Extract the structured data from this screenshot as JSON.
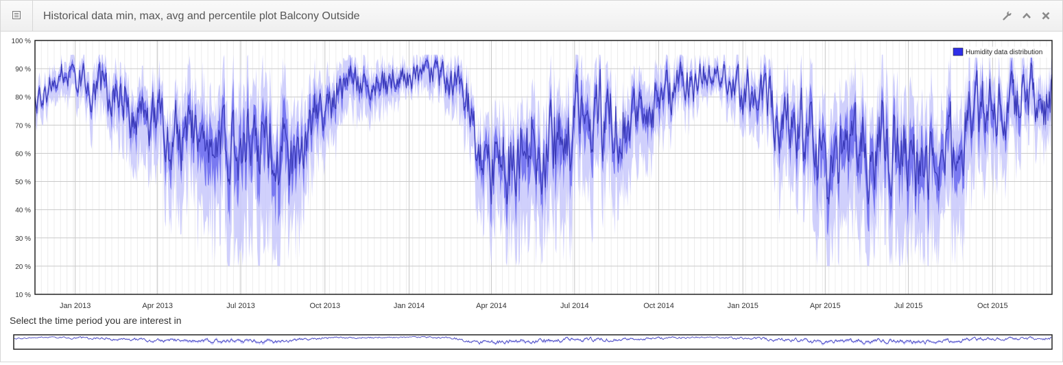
{
  "header": {
    "title": "Historical data min, max, avg and percentile plot Balcony Outside",
    "icons": [
      "list-icon",
      "wrench-icon",
      "chevron-up-icon",
      "close-icon"
    ]
  },
  "colors": {
    "avg_line": "#3a3ab8",
    "percentile_band": "#6a6aee",
    "minmax_band": "#c8c8fb",
    "legend_swatch": "#2f2fe8"
  },
  "legend": {
    "label": "Humidity data distribution",
    "position": "top-right"
  },
  "selector": {
    "label": "Select the time period you are interest in"
  },
  "chart_data": {
    "type": "area",
    "title": "Historical data min, max, avg and percentile plot Balcony Outside",
    "series_name": "Humidity data distribution",
    "x_range": [
      "2012-11-18",
      "2015-12-05"
    ],
    "x_ticks": [
      {
        "date": "2013-01-01",
        "label": "Jan 2013"
      },
      {
        "date": "2013-04-01",
        "label": "Apr 2013"
      },
      {
        "date": "2013-07-01",
        "label": "Jul 2013"
      },
      {
        "date": "2013-10-01",
        "label": "Oct 2013"
      },
      {
        "date": "2014-01-01",
        "label": "Jan 2014"
      },
      {
        "date": "2014-04-01",
        "label": "Apr 2014"
      },
      {
        "date": "2014-07-01",
        "label": "Jul 2014"
      },
      {
        "date": "2014-10-01",
        "label": "Oct 2014"
      },
      {
        "date": "2015-01-01",
        "label": "Jan 2015"
      },
      {
        "date": "2015-04-01",
        "label": "Apr 2015"
      },
      {
        "date": "2015-07-01",
        "label": "Jul 2015"
      },
      {
        "date": "2015-10-01",
        "label": "Oct 2015"
      }
    ],
    "y_range": [
      10,
      100
    ],
    "y_ticks": [
      {
        "v": 100,
        "label": "100 %"
      },
      {
        "v": 90,
        "label": "90 %"
      },
      {
        "v": 80,
        "label": "80 %"
      },
      {
        "v": 70,
        "label": "70 %"
      },
      {
        "v": 60,
        "label": "60 %"
      },
      {
        "v": 50,
        "label": "50 %"
      },
      {
        "v": 40,
        "label": "40 %"
      },
      {
        "v": 30,
        "label": "30 %"
      },
      {
        "v": 20,
        "label": "20 %"
      },
      {
        "v": 10,
        "label": "10 %"
      }
    ],
    "grid": true,
    "avg": [
      [
        "2012-11-18",
        76
      ],
      [
        "2012-11-28",
        84
      ],
      [
        "2012-12-08",
        87
      ],
      [
        "2012-12-18",
        88
      ],
      [
        "2013-01-01",
        86
      ],
      [
        "2013-01-15",
        84
      ],
      [
        "2013-02-01",
        83
      ],
      [
        "2013-02-15",
        80
      ],
      [
        "2013-03-01",
        78
      ],
      [
        "2013-03-15",
        74
      ],
      [
        "2013-04-01",
        72
      ],
      [
        "2013-04-15",
        69
      ],
      [
        "2013-05-01",
        68
      ],
      [
        "2013-05-15",
        66
      ],
      [
        "2013-06-01",
        64
      ],
      [
        "2013-06-15",
        63
      ],
      [
        "2013-07-01",
        61
      ],
      [
        "2013-07-15",
        59
      ],
      [
        "2013-08-01",
        58
      ],
      [
        "2013-08-15",
        57
      ],
      [
        "2013-09-01",
        64
      ],
      [
        "2013-09-15",
        72
      ],
      [
        "2013-10-01",
        78
      ],
      [
        "2013-10-15",
        82
      ],
      [
        "2013-11-01",
        85
      ],
      [
        "2013-11-15",
        86
      ],
      [
        "2013-12-01",
        86
      ],
      [
        "2013-12-15",
        86
      ],
      [
        "2014-01-01",
        86
      ],
      [
        "2014-01-15",
        87
      ],
      [
        "2014-02-01",
        86
      ],
      [
        "2014-02-15",
        84
      ],
      [
        "2014-03-01",
        80
      ],
      [
        "2014-03-15",
        62
      ],
      [
        "2014-04-01",
        60
      ],
      [
        "2014-04-15",
        62
      ],
      [
        "2014-05-01",
        63
      ],
      [
        "2014-05-15",
        61
      ],
      [
        "2014-06-01",
        60
      ],
      [
        "2014-06-15",
        62
      ],
      [
        "2014-07-01",
        66
      ],
      [
        "2014-07-15",
        68
      ],
      [
        "2014-08-01",
        70
      ],
      [
        "2014-08-15",
        72
      ],
      [
        "2014-09-01",
        73
      ],
      [
        "2014-09-15",
        74
      ],
      [
        "2014-10-01",
        77
      ],
      [
        "2014-10-15",
        80
      ],
      [
        "2014-11-01",
        84
      ],
      [
        "2014-11-15",
        88
      ],
      [
        "2014-12-01",
        90
      ],
      [
        "2014-12-15",
        88
      ],
      [
        "2015-01-01",
        84
      ],
      [
        "2015-01-15",
        82
      ],
      [
        "2015-02-01",
        78
      ],
      [
        "2015-02-15",
        74
      ],
      [
        "2015-03-01",
        68
      ],
      [
        "2015-03-15",
        62
      ],
      [
        "2015-04-01",
        56
      ],
      [
        "2015-04-15",
        58
      ],
      [
        "2015-05-01",
        62
      ],
      [
        "2015-05-15",
        64
      ],
      [
        "2015-06-01",
        62
      ],
      [
        "2015-06-15",
        60
      ],
      [
        "2015-07-01",
        55
      ],
      [
        "2015-07-15",
        54
      ],
      [
        "2015-08-01",
        56
      ],
      [
        "2015-08-15",
        60
      ],
      [
        "2015-09-01",
        66
      ],
      [
        "2015-09-15",
        70
      ],
      [
        "2015-10-01",
        74
      ],
      [
        "2015-10-15",
        78
      ],
      [
        "2015-11-01",
        82
      ],
      [
        "2015-11-15",
        84
      ],
      [
        "2015-12-05",
        78
      ]
    ],
    "band_width": [
      [
        "2012-11-18",
        3
      ],
      [
        "2013-01-01",
        4
      ],
      [
        "2013-04-01",
        10
      ],
      [
        "2013-07-01",
        20
      ],
      [
        "2013-08-15",
        18
      ],
      [
        "2013-10-01",
        8
      ],
      [
        "2014-01-01",
        3
      ],
      [
        "2014-03-01",
        6
      ],
      [
        "2014-04-01",
        14
      ],
      [
        "2014-06-01",
        16
      ],
      [
        "2014-08-01",
        12
      ],
      [
        "2014-10-01",
        8
      ],
      [
        "2014-12-01",
        3
      ],
      [
        "2015-02-01",
        8
      ],
      [
        "2015-04-01",
        16
      ],
      [
        "2015-07-01",
        18
      ],
      [
        "2015-09-01",
        14
      ],
      [
        "2015-11-01",
        8
      ],
      [
        "2015-12-05",
        6
      ]
    ],
    "variability": [
      [
        "2012-11-18",
        0.4
      ],
      [
        "2013-01-01",
        0.4
      ],
      [
        "2013-03-01",
        0.8
      ],
      [
        "2013-06-01",
        1.1
      ],
      [
        "2013-08-15",
        1.2
      ],
      [
        "2013-10-01",
        0.6
      ],
      [
        "2014-01-01",
        0.35
      ],
      [
        "2014-02-15",
        0.5
      ],
      [
        "2014-04-01",
        1.1
      ],
      [
        "2014-06-01",
        1.2
      ],
      [
        "2014-08-01",
        1.1
      ],
      [
        "2014-10-01",
        0.7
      ],
      [
        "2014-12-01",
        0.35
      ],
      [
        "2015-02-01",
        0.9
      ],
      [
        "2015-04-01",
        1.2
      ],
      [
        "2015-07-01",
        1.2
      ],
      [
        "2015-09-01",
        1.0
      ],
      [
        "2015-11-01",
        0.8
      ],
      [
        "2015-12-05",
        0.9
      ]
    ],
    "min_value": 20,
    "max_value": 95
  }
}
